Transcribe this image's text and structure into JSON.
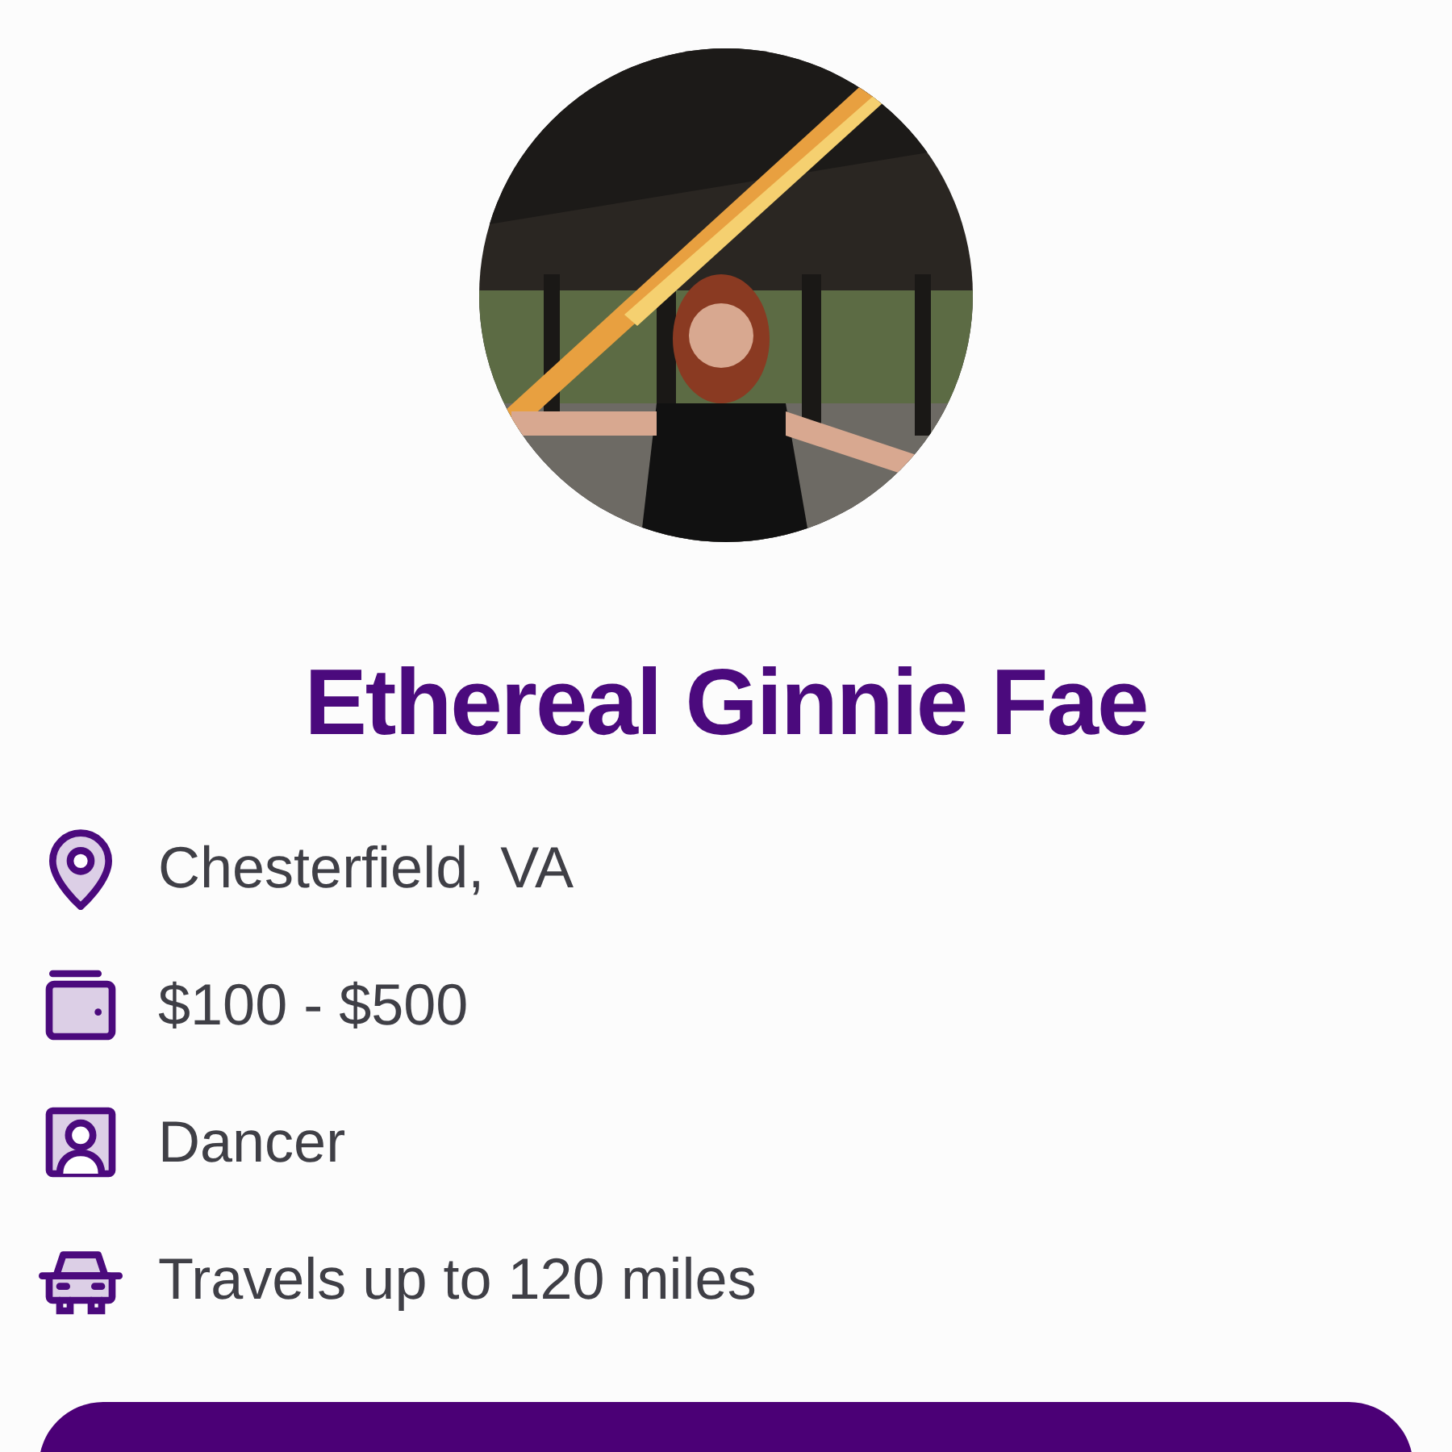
{
  "profile": {
    "name": "Ethereal Ginnie Fae"
  },
  "details": [
    {
      "kind": "location",
      "text": "Chesterfield, VA"
    },
    {
      "kind": "price",
      "text": "$100 - $500"
    },
    {
      "kind": "role",
      "text": "Dancer"
    },
    {
      "kind": "travel",
      "text": "Travels up to 120 miles"
    }
  ]
}
